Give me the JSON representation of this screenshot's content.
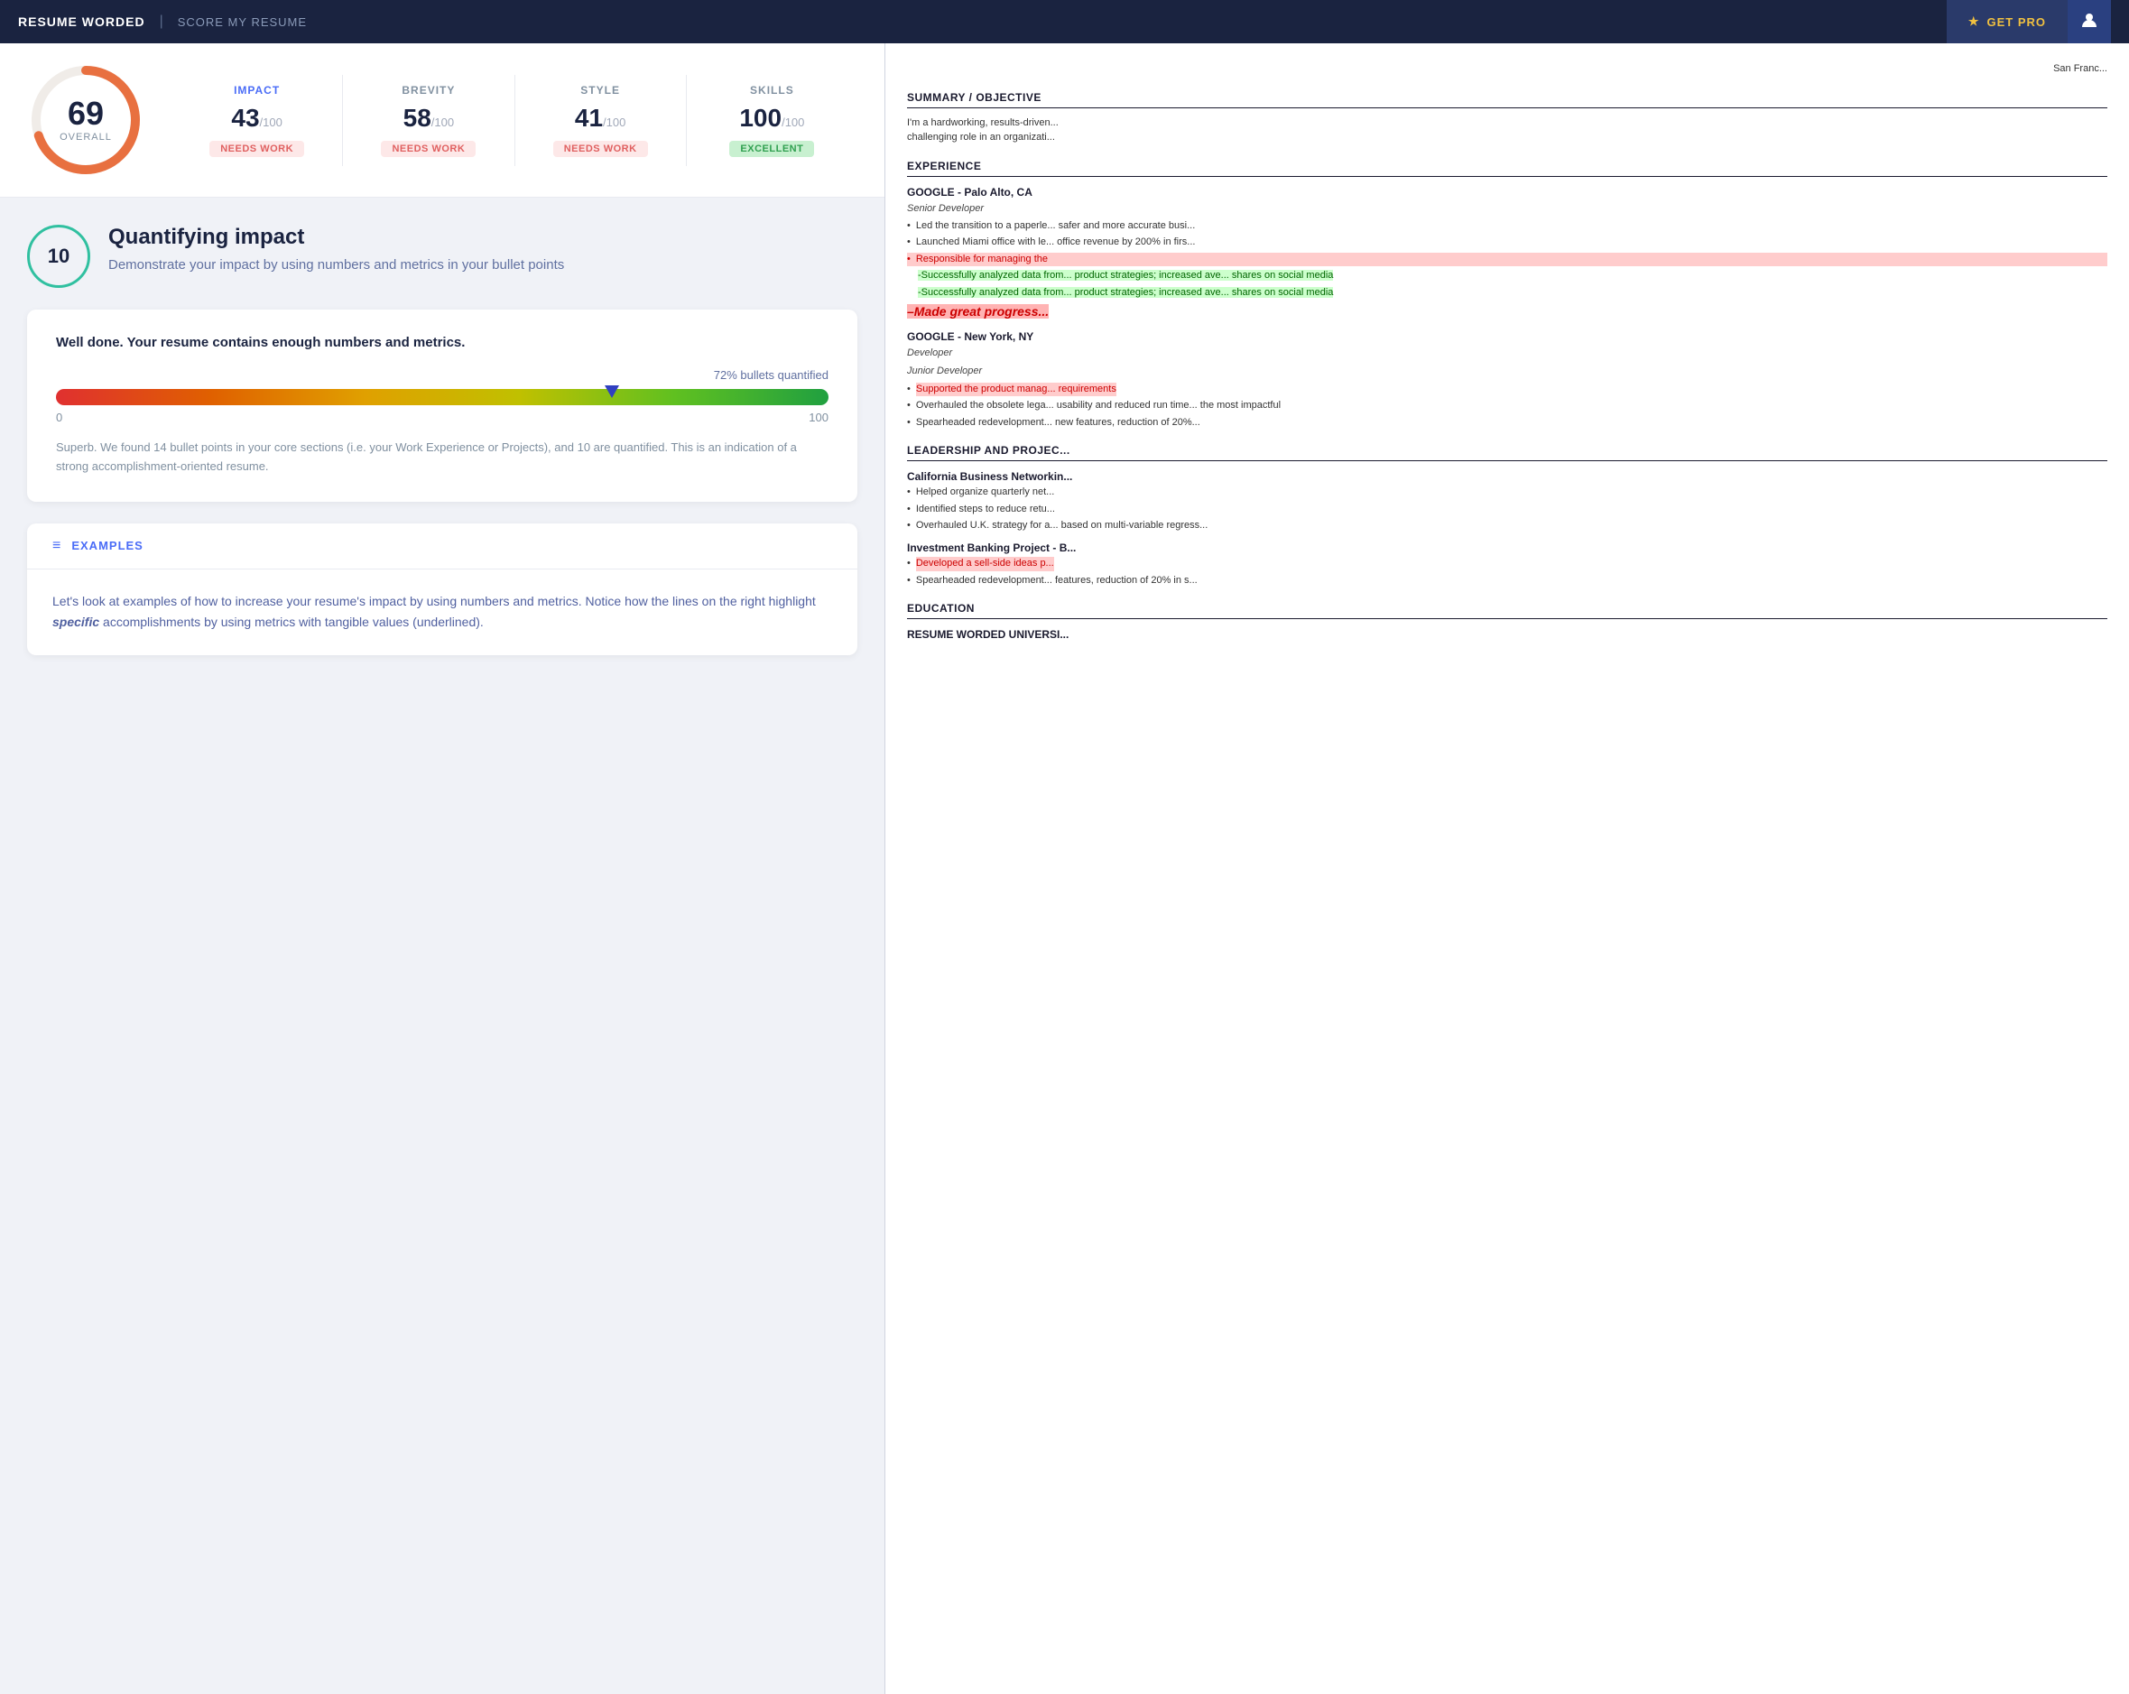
{
  "nav": {
    "brand": "RESUME WORDED",
    "divider": "|",
    "subtitle": "SCORE MY RESUME",
    "get_pro": "GET PRO",
    "star_icon": "★",
    "user_icon": "👤"
  },
  "score": {
    "overall": 69,
    "overall_label": "OVERALL",
    "categories": [
      {
        "name": "IMPACT",
        "value": 43,
        "max": 100,
        "badge": "NEEDS WORK",
        "badge_type": "needs-work",
        "active": true
      },
      {
        "name": "BREVITY",
        "value": 58,
        "max": 100,
        "badge": "NEEDS WORK",
        "badge_type": "needs-work"
      },
      {
        "name": "STYLE",
        "value": 41,
        "max": 100,
        "badge": "NEEDS WORK",
        "badge_type": "needs-work"
      },
      {
        "name": "SKILLS",
        "value": 100,
        "max": 100,
        "badge": "EXCELLENT",
        "badge_type": "excellent"
      }
    ]
  },
  "quantifying": {
    "number": 10,
    "title": "Quantifying impact",
    "description": "Demonstrate your impact by using numbers and metrics in your bullet points",
    "card_title": "Well done. Your resume contains enough numbers and metrics.",
    "progress_label": "72% bullets quantified",
    "progress_value": 72,
    "progress_min": 0,
    "progress_max": 100,
    "description_long": "Superb. We found 14 bullet points in your core sections (i.e. your Work Experience or Projects), and 10 are quantified. This is an indication of a strong accomplishment-oriented resume."
  },
  "examples": {
    "icon": "≡",
    "title": "EXAMPLES",
    "body": "Let's look at examples of how to increase your resume's impact by using numbers and metrics. Notice how the lines on the right highlight specific accomplishments by using metrics with tangible values (underlined)."
  },
  "resume": {
    "location": "San Franc...",
    "summary_title": "SUMMARY / OBJECTIVE",
    "summary_text": "I'm a hardworking, results-driven... challenging role in an organizati...",
    "experience_title": "EXPERIENCE",
    "companies": [
      {
        "name": "GOOGLE - Palo Alto, CA",
        "role1": "Senior Developer",
        "bullets": [
          {
            "text": "Led the transition to a paperle... safer and more accurate busi...",
            "highlight": "none"
          },
          {
            "text": "Launched Miami office with le... office revenue by 200% in firs...",
            "highlight": "none"
          },
          {
            "text": "Responsible for managing the",
            "highlight": "red"
          },
          {
            "text": "-Successfully analyzed data from... product strategies; increased ave... shares on social media",
            "highlight": "green"
          },
          {
            "text": "-Successfully analyzed data from... product strategies; increased ave... shares on social media",
            "highlight": "green"
          }
        ],
        "extra": "–Made great progress...",
        "extra_highlight": "pink"
      },
      {
        "name": "GOOGLE - New York, NY",
        "role1": "Developer",
        "role2": "Junior Developer",
        "bullets": [
          {
            "text": "Supported the product manag... requirements",
            "highlight": "red"
          },
          {
            "text": "Overhauled the obsolete lega... usability and reduced run time... the most impactful",
            "highlight": "none"
          },
          {
            "text": "Spearheaded redevelopment... new features, reduction of 20%...",
            "highlight": "none"
          }
        ]
      }
    ],
    "leadership_title": "LEADERSHIP AND PROJEC...",
    "leadership": [
      {
        "name": "California Business Networkin...",
        "bullets": [
          {
            "text": "Helped organize quarterly net..."
          },
          {
            "text": "Identified steps to reduce retu..."
          },
          {
            "text": "Overhauled U.K. strategy for a... based on multi-variable regress..."
          }
        ]
      },
      {
        "name": "Investment Banking Project - B...",
        "bullets": [
          {
            "text": "Developed a sell-side ideas p...",
            "highlight": "red"
          },
          {
            "text": "Spearheaded redevelopment... features, reduction of 20% in s..."
          }
        ]
      }
    ],
    "education_title": "EDUCATION",
    "education": [
      {
        "name": "RESUME WORDED UNIVERSI..."
      }
    ]
  }
}
